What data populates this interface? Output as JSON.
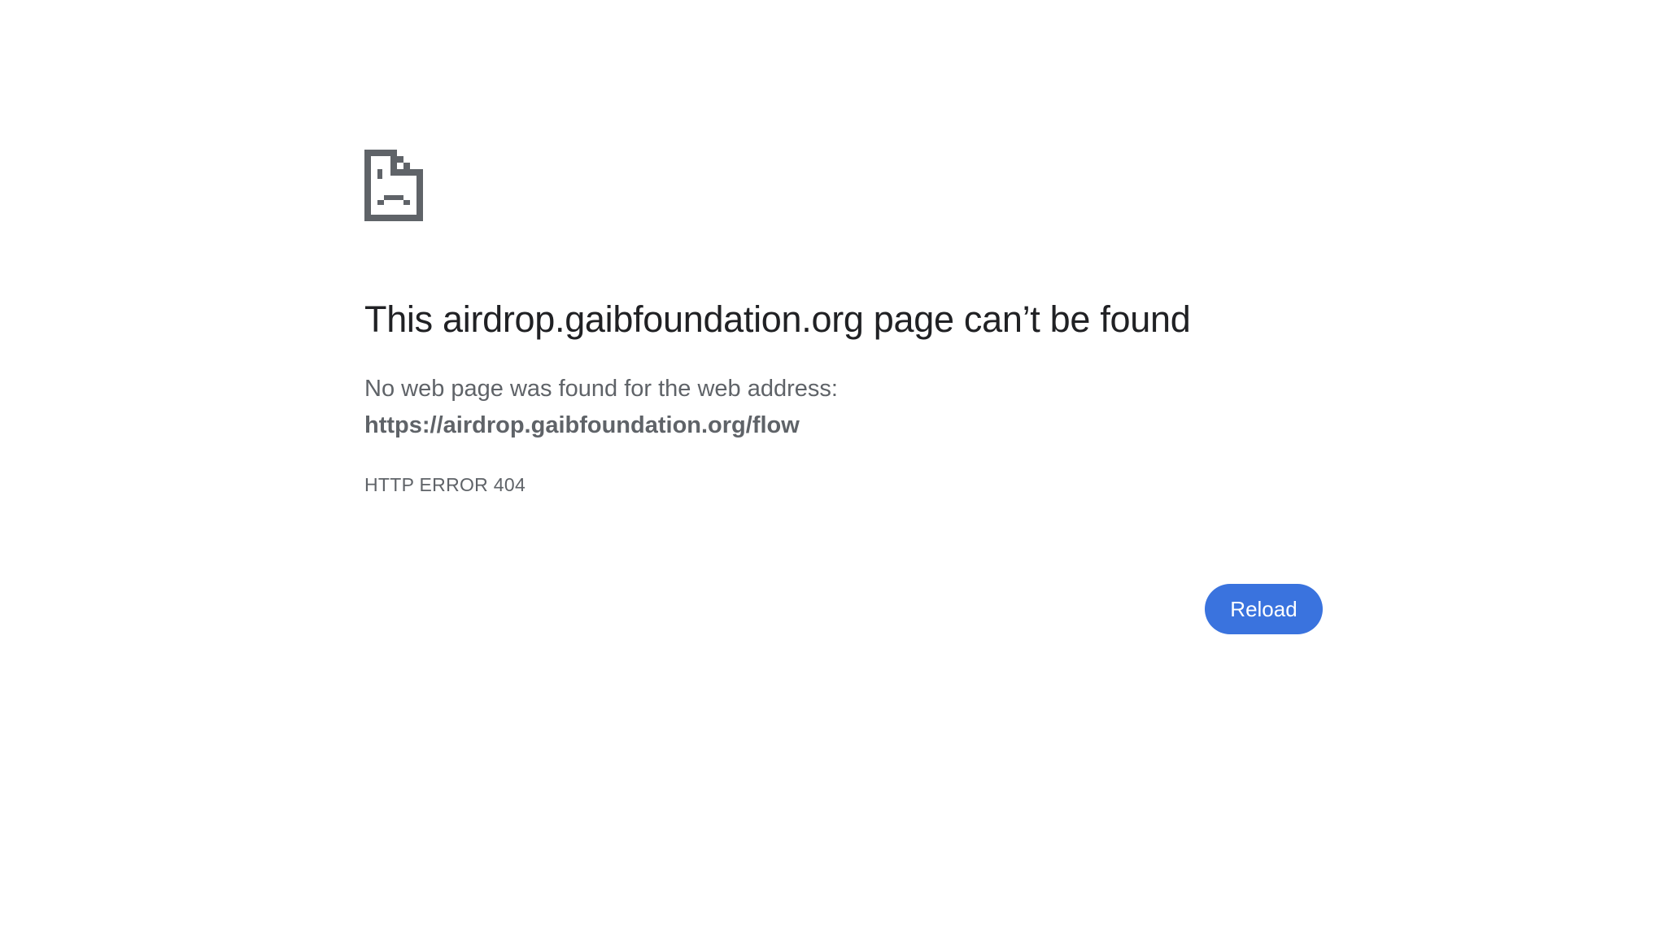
{
  "error_icon": "sad-page-icon",
  "title": "This airdrop.gaibfoundation.org page can’t be found",
  "summary": "No web page was found for the web address:",
  "url": "https://airdrop.gaibfoundation.org/flow",
  "error_code": "HTTP ERROR 404",
  "reload_label": "Reload",
  "colors": {
    "background": "#ffffff",
    "title": "#202124",
    "body_text": "#5f6368",
    "button": "#3a73de",
    "icon": "#5f6368"
  }
}
